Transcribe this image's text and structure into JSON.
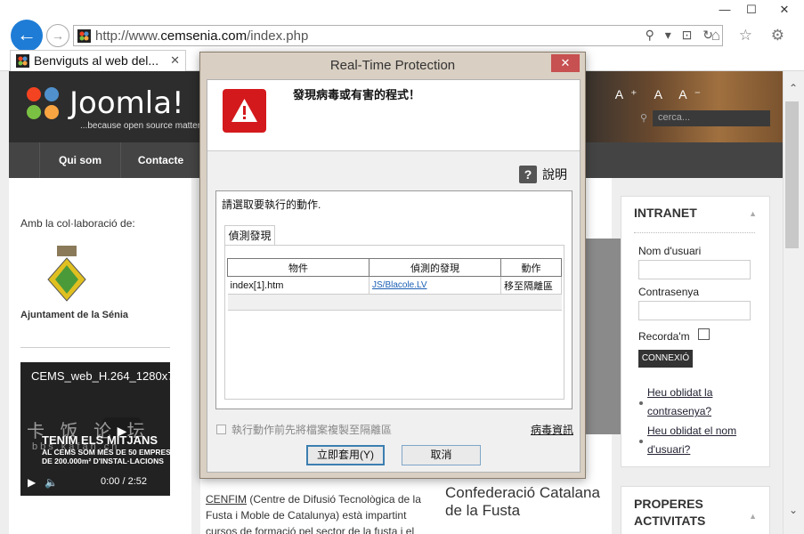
{
  "browser": {
    "window_controls": [
      "—",
      "☐",
      "✕"
    ],
    "url_prefix": "http://www.",
    "url_domain": "cemsenia.com",
    "url_path": "/index.php",
    "address_tools": "⚲ ▾ ⊡ ↻",
    "tab_title": "Benviguts al web del...",
    "tab_close": "✕",
    "toolbar_icons": "⌂ ☆ ⚙"
  },
  "site": {
    "logo_text": "Joomla!",
    "logo_tagline": "...because open source matters",
    "font_controls": "A⁺ A A⁻",
    "search_placeholder": "cerca...",
    "menu": [
      "Qui som",
      "Contacte"
    ],
    "collab_label": "Amb la col·laboració de:",
    "ajuntament": "Ajuntament de la Sénia",
    "video": {
      "title": "CEMS_web_H.264_1280x7",
      "headline": "TENIM ELS MITJANS",
      "line2": "AL CEMS SOM MÉS DE 50 EMPRES",
      "line3": "DE 200.000m² D'INSTAL·LACIONS",
      "time": "0:00 / 2:52"
    },
    "watermark": "卡 饭 论 坛",
    "watermark_url": "bbs.kafan.cn",
    "cenfim_link": "CENFIM",
    "cenfim_text": " (Centre de Difusió Tecnològica de la Fusta i Moble de Catalunya) està impartint cursos de formació pel sector de la fusta i el",
    "confederacio": "Confederació Catalana de la Fusta",
    "intranet": {
      "title": "INTRANET",
      "user_label": "Nom d'usuari",
      "pass_label": "Contrasenya",
      "remember_label": "Recorda'm",
      "login_button": "CONNEXIÓ",
      "forgot_password": "Heu oblidat la contrasenya?",
      "forgot_user": "Heu oblidat el nom d'usuari?"
    },
    "activities_title": "PROPERES ACTIVITATS"
  },
  "dialog": {
    "title": "Real-Time Protection",
    "close": "✕",
    "message": "發現病毒或有害的程式！",
    "help_label": "說明",
    "prompt": "請選取要執行的動作.",
    "tab_label": "偵測發現",
    "columns": [
      "物件",
      "偵測的發現",
      "動作"
    ],
    "rows": [
      {
        "object": "index[1].htm",
        "detection": "JS/Blacole.LV",
        "action": "移至隔離區"
      }
    ],
    "option_label": "執行動作前先將檔案複製至隔離區",
    "virus_info": "病毒資訊",
    "apply_button": "立即套用(Y)",
    "cancel_button": "取消"
  },
  "colors": {
    "accent_blue": "#1e7cd6",
    "warning_red": "#d3191c",
    "dialog_frame": "#d9cfc2"
  }
}
